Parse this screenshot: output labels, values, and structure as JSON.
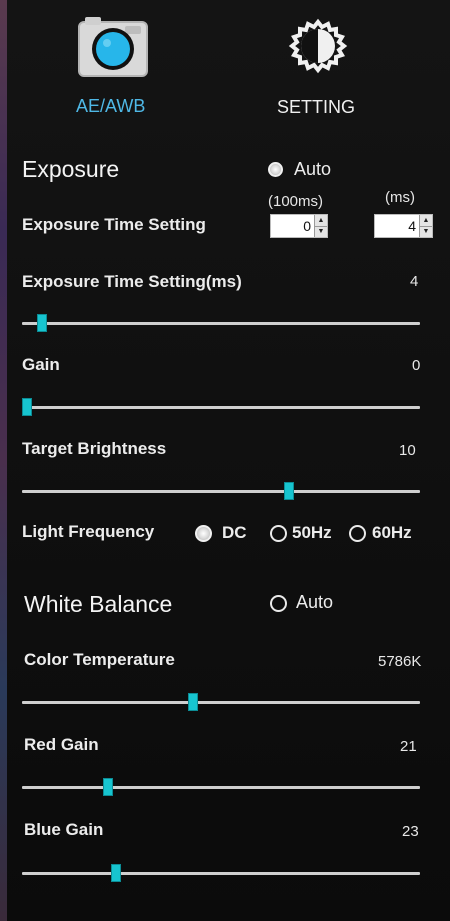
{
  "tabs": [
    {
      "label": "AE/AWB",
      "icon": "camera-icon",
      "active": true,
      "color": "#4fb8e6"
    },
    {
      "label": "SETTING",
      "icon": "contrast-gear-icon",
      "active": false,
      "color": "#f0f0f0"
    }
  ],
  "exposure": {
    "title": "Exposure",
    "auto_label": "Auto",
    "auto_checked": true,
    "time_setting": {
      "label": "Exposure Time Setting",
      "unit_coarse": "(100ms)",
      "unit_fine": "(ms)",
      "value_coarse": "0",
      "value_fine": "4"
    },
    "time_ms": {
      "label": "Exposure Time Setting(ms)",
      "value": "4",
      "fraction": 0.05
    },
    "gain": {
      "label": "Gain",
      "value": "0",
      "fraction": 0.0
    },
    "target_brightness": {
      "label": "Target Brightness",
      "value": "10",
      "fraction": 0.67
    },
    "light_frequency": {
      "label": "Light Frequency",
      "options": [
        {
          "label": "DC",
          "checked": true
        },
        {
          "label": "50Hz",
          "checked": false
        },
        {
          "label": "60Hz",
          "checked": false
        }
      ]
    }
  },
  "white_balance": {
    "title": "White Balance",
    "auto_label": "Auto",
    "auto_checked": false,
    "color_temperature": {
      "label": "Color Temperature",
      "value": "5786K",
      "fraction": 0.43
    },
    "red_gain": {
      "label": "Red Gain",
      "value": "21",
      "fraction": 0.215
    },
    "blue_gain": {
      "label": "Blue Gain",
      "value": "23",
      "fraction": 0.235
    }
  },
  "colors": {
    "accent": "#17c4cf",
    "active_tab": "#4fb8e6",
    "background": "#101010",
    "track": "#cfcfcf"
  }
}
